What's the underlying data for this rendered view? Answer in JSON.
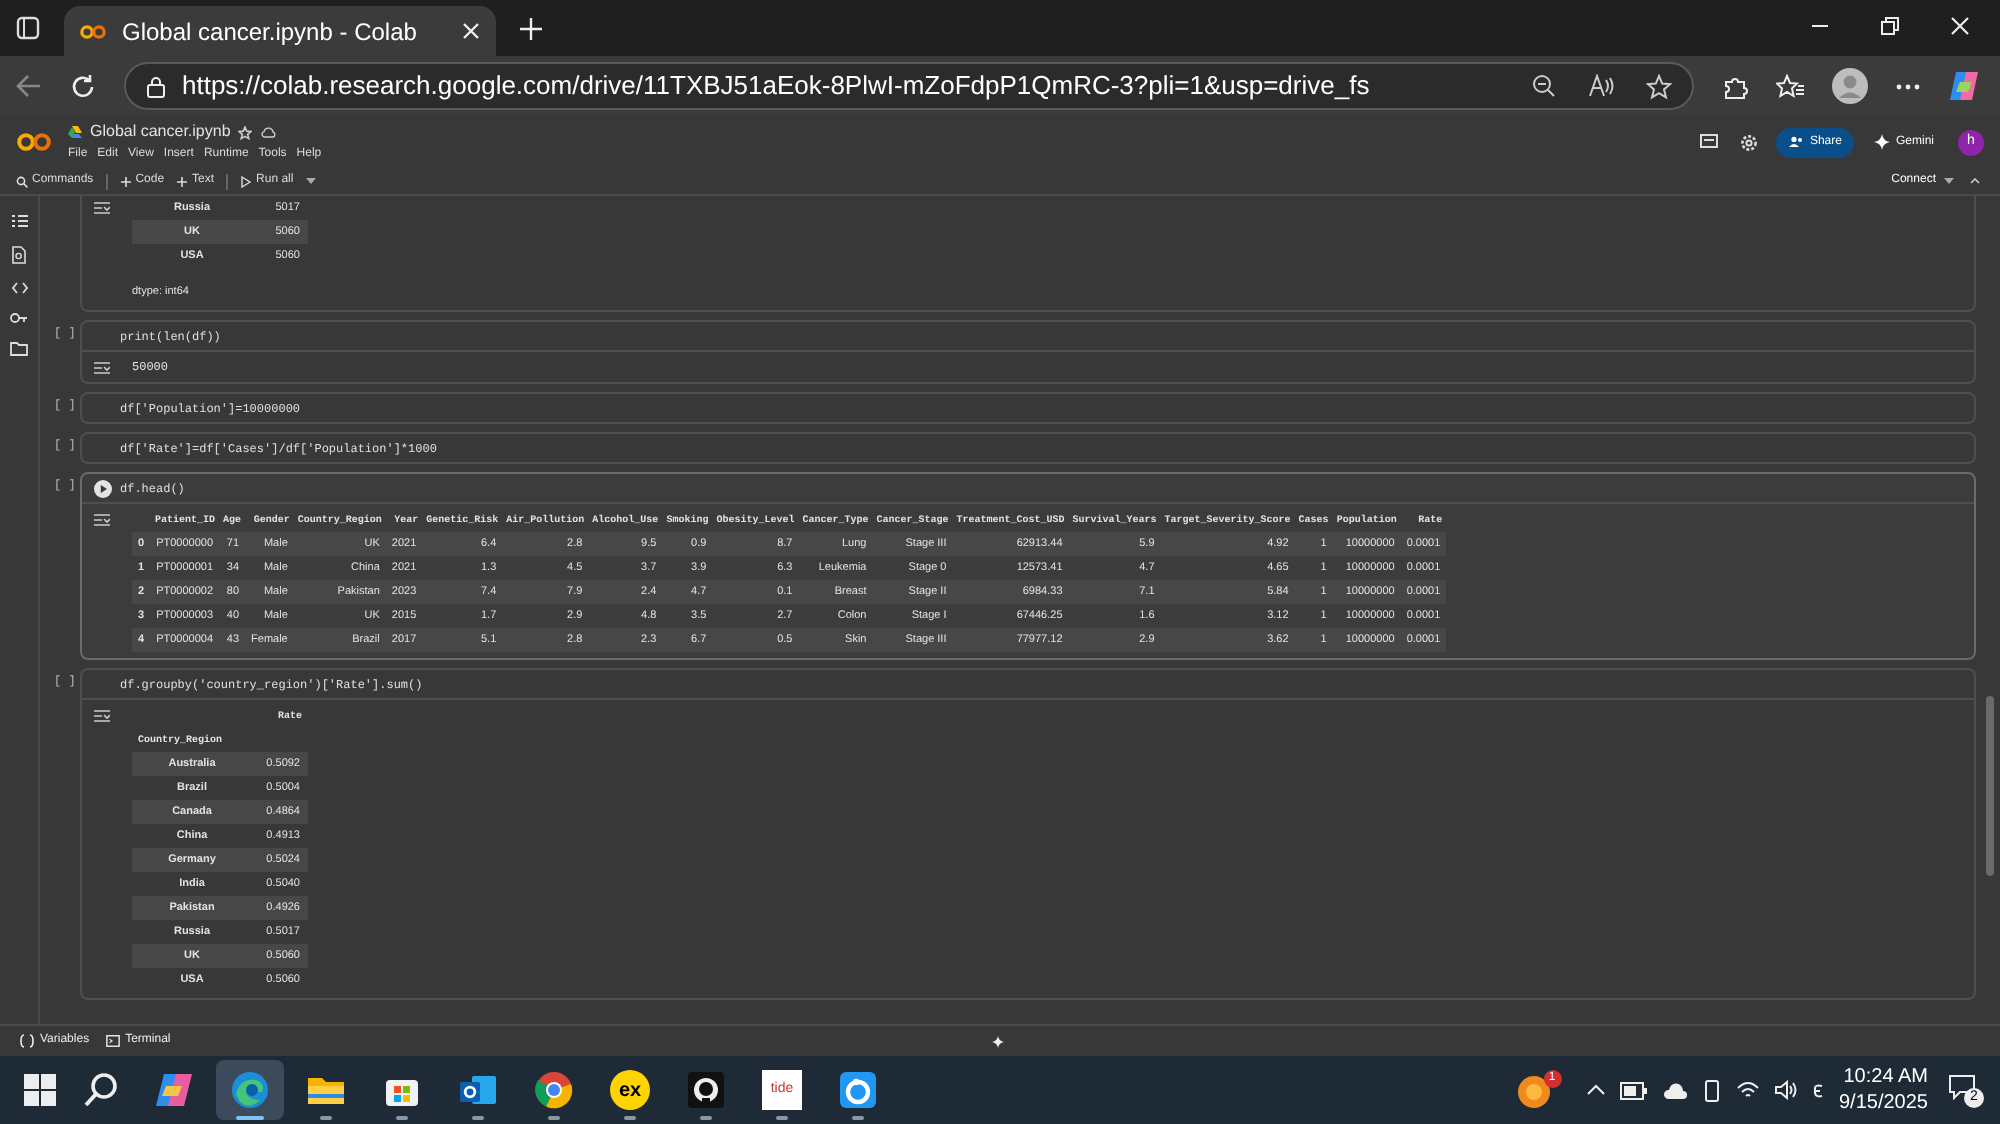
{
  "browser": {
    "tab_title": "Global cancer.ipynb - Colab",
    "url": "https://colab.research.google.com/drive/11TXBJ51aEok-8PlwI-mZoFdpP1QmRC-3?pli=1&usp=drive_fs"
  },
  "colab": {
    "notebook_title": "Global cancer.ipynb",
    "menu": [
      "File",
      "Edit",
      "View",
      "Insert",
      "Runtime",
      "Tools",
      "Help"
    ],
    "share": "Share",
    "gemini": "Gemini",
    "avatar": "h",
    "toolbar": [
      {
        "kind": "search",
        "label": "Commands"
      },
      {
        "kind": "add",
        "label": "Code"
      },
      {
        "kind": "add",
        "label": "Text"
      },
      {
        "kind": "run",
        "label": "Run all"
      }
    ],
    "connect": "Connect"
  },
  "cells": [
    {
      "output": {
        "kind": "series",
        "rows": [
          [
            "Russia",
            "5017"
          ],
          [
            "UK",
            "5060"
          ],
          [
            "USA",
            "5060"
          ]
        ],
        "footer": "dtype: int64"
      }
    },
    {
      "bracket": "[ ]",
      "focused": false,
      "code": "print(len(df))",
      "output": {
        "kind": "text",
        "text": "50000"
      }
    },
    {
      "bracket": "[ ]",
      "focused": false,
      "code": "df['Population']=10000000"
    },
    {
      "bracket": "[ ]",
      "focused": false,
      "code": "df['Rate']=df['Cases']/df['Population']*1000"
    },
    {
      "bracket": "[ ]",
      "focused": true,
      "code": "df.head()",
      "output": {
        "kind": "dataframe",
        "columns": [
          "",
          "Patient_ID",
          "Age",
          "Gender",
          "Country_Region",
          "Year",
          "Genetic_Risk",
          "Air_Pollution",
          "Alcohol_Use",
          "Smoking",
          "Obesity_Level",
          "Cancer_Type",
          "Cancer_Stage",
          "Treatment_Cost_USD",
          "Survival_Years",
          "Target_Severity_Score",
          "Cases",
          "Population",
          "Rate"
        ],
        "rows": [
          [
            "0",
            "PT0000000",
            "71",
            "Male",
            "UK",
            "2021",
            "6.4",
            "2.8",
            "9.5",
            "0.9",
            "8.7",
            "Lung",
            "Stage III",
            "62913.44",
            "5.9",
            "4.92",
            "1",
            "10000000",
            "0.0001"
          ],
          [
            "1",
            "PT0000001",
            "34",
            "Male",
            "China",
            "2021",
            "1.3",
            "4.5",
            "3.7",
            "3.9",
            "6.3",
            "Leukemia",
            "Stage 0",
            "12573.41",
            "4.7",
            "4.65",
            "1",
            "10000000",
            "0.0001"
          ],
          [
            "2",
            "PT0000002",
            "80",
            "Male",
            "Pakistan",
            "2023",
            "7.4",
            "7.9",
            "2.4",
            "4.7",
            "0.1",
            "Breast",
            "Stage II",
            "6984.33",
            "7.1",
            "5.84",
            "1",
            "10000000",
            "0.0001"
          ],
          [
            "3",
            "PT0000003",
            "40",
            "Male",
            "UK",
            "2015",
            "1.7",
            "2.9",
            "4.8",
            "3.5",
            "2.7",
            "Colon",
            "Stage I",
            "67446.25",
            "1.6",
            "3.12",
            "1",
            "10000000",
            "0.0001"
          ],
          [
            "4",
            "PT0000004",
            "43",
            "Female",
            "Brazil",
            "2017",
            "5.1",
            "2.8",
            "2.3",
            "6.7",
            "0.5",
            "Skin",
            "Stage III",
            "77977.12",
            "2.9",
            "3.62",
            "1",
            "10000000",
            "0.0001"
          ]
        ]
      }
    },
    {
      "bracket": "[ ]",
      "focused": false,
      "code": "df.groupby('country_region')['Rate'].sum()",
      "output": {
        "kind": "series",
        "column": "Rate",
        "index_name": "Country_Region",
        "rows": [
          [
            "Australia",
            "0.5092"
          ],
          [
            "Brazil",
            "0.5004"
          ],
          [
            "Canada",
            "0.4864"
          ],
          [
            "China",
            "0.4913"
          ],
          [
            "Germany",
            "0.5024"
          ],
          [
            "India",
            "0.5040"
          ],
          [
            "Pakistan",
            "0.4926"
          ],
          [
            "Russia",
            "0.5017"
          ],
          [
            "UK",
            "0.5060"
          ],
          [
            "USA",
            "0.5060"
          ]
        ]
      }
    }
  ],
  "bottom_bar": [
    "Variables",
    "Terminal"
  ],
  "taskbar": {
    "apps": [
      {
        "kind": "copilot",
        "selected": false
      },
      {
        "kind": "edge",
        "selected": true
      },
      {
        "kind": "explorer",
        "selected": false
      },
      {
        "kind": "store",
        "selected": false
      },
      {
        "kind": "outlook",
        "selected": false
      },
      {
        "kind": "chrome",
        "selected": false
      },
      {
        "kind": "ex",
        "label": "ex",
        "selected": false
      },
      {
        "kind": "github",
        "selected": false
      },
      {
        "kind": "tide",
        "label": "tide",
        "selected": false
      },
      {
        "kind": "ring",
        "selected": false
      }
    ],
    "badge": "1",
    "time": "10:24 AM",
    "date": "9/15/2025",
    "notifications": "2"
  }
}
